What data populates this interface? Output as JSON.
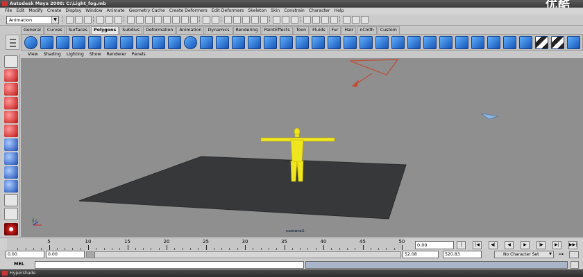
{
  "window": {
    "title": "Autodesk Maya 2008: C:\\Light_fog.mb",
    "watermark": "优酷"
  },
  "menubar": [
    "File",
    "Edit",
    "Modify",
    "Create",
    "Display",
    "Window",
    "Animate",
    "Geometry Cache",
    "Create Deformers",
    "Edit Deformers",
    "Skeleton",
    "Skin",
    "Constrain",
    "Character",
    "Help"
  ],
  "statusline": {
    "mode": "Animation",
    "mode_arrow": "▼"
  },
  "shelf_tabs": [
    "General",
    "Curves",
    "Surfaces",
    "Polygons",
    "Subdivs",
    "Deformation",
    "Animation",
    "Dynamics",
    "Rendering",
    "PaintEffects",
    "Toon",
    "Fluids",
    "Fur",
    "Hair",
    "nCloth",
    "Custom"
  ],
  "shelf_active_tab": "Polygons",
  "panel_menu": [
    "View",
    "Shading",
    "Lighting",
    "Show",
    "Renderer",
    "Panels"
  ],
  "viewport": {
    "camera_label": "camera1",
    "axis_label": "y  z"
  },
  "timeslider": {
    "tick_labels": [
      "5",
      "10",
      "15",
      "20",
      "25",
      "30",
      "35",
      "40",
      "45",
      "50"
    ],
    "current_frame": "0.00",
    "buttons": [
      "|◀◀",
      "|◀",
      "◀|",
      "◀",
      "▶",
      "|▶",
      "▶|",
      "▶▶|"
    ]
  },
  "range": {
    "start_time": "0.00",
    "playback_start": "0.00",
    "playback_end": "52.08",
    "end_time": "520.83",
    "character_set": "No Character Set",
    "character_set_arrow": "▼",
    "key_icon": "⊶"
  },
  "cmdline": {
    "label": "MEL"
  },
  "bottom_window": {
    "title": "Hypershade"
  },
  "colors": {
    "viewport_bg": "#8f8f8f",
    "ground_plane": "#36383a",
    "character": "#f0e620",
    "shelf_blue": "#1654b6"
  },
  "icons": [
    "select-icon",
    "lasso-icon",
    "move-icon",
    "rotate-icon",
    "scale-icon",
    "manipulator-icon",
    "poly-sphere-icon",
    "poly-cube-icon",
    "maya-logo-icon"
  ]
}
